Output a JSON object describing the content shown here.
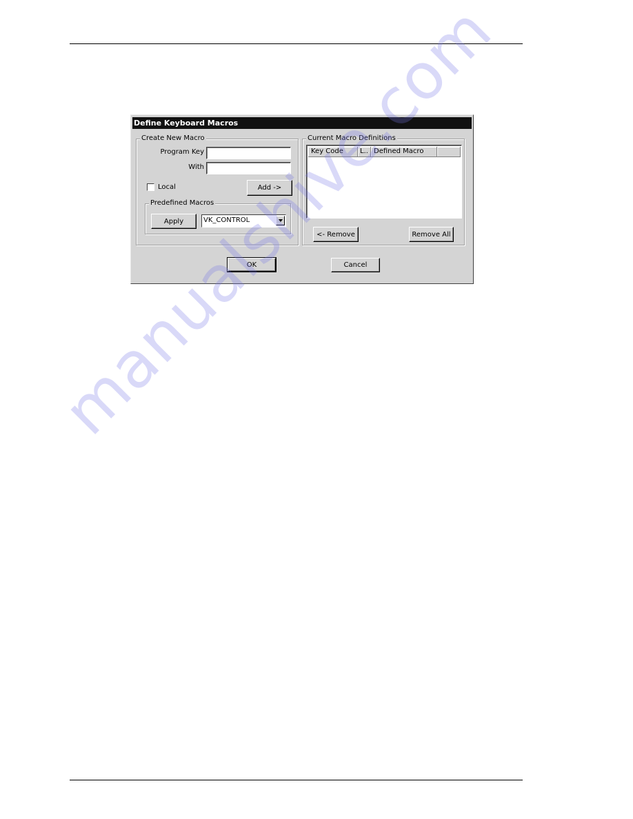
{
  "dialog": {
    "title": "Define Keyboard Macros",
    "create_group": {
      "label": "Create New Macro",
      "program_key_label": "Program Key",
      "program_key_value": "",
      "with_label": "With",
      "with_value": "",
      "local_checkbox_label": "Local",
      "local_checked": false,
      "add_button": "Add ->"
    },
    "predefined_group": {
      "label": "Predefined Macros",
      "apply_button": "Apply",
      "selected_macro": "VK_CONTROL"
    },
    "definitions_group": {
      "label": "Current Macro Definitions",
      "columns": [
        "Key Code",
        "L..",
        "Defined Macro",
        ""
      ],
      "rows": [],
      "remove_button": "<- Remove",
      "remove_all_button": "Remove All"
    },
    "ok_button": "OK",
    "cancel_button": "Cancel"
  },
  "watermark": "manualshive.com"
}
